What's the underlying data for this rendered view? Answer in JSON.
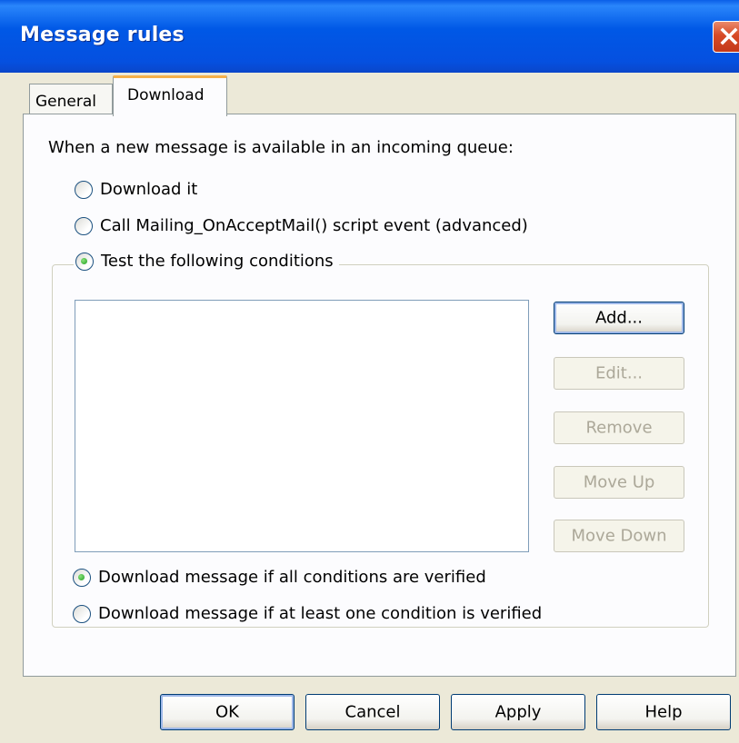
{
  "window": {
    "title": "Message rules",
    "close_icon": "close-icon"
  },
  "tabs": [
    {
      "label": "General",
      "active": false
    },
    {
      "label": "Download",
      "active": true
    }
  ],
  "content": {
    "intro": "When a new message is available in an incoming queue:",
    "options": [
      {
        "label": "Download it",
        "checked": false
      },
      {
        "label": "Call Mailing_OnAcceptMail() script event (advanced)",
        "checked": false
      },
      {
        "label": "Test the following conditions",
        "checked": true
      }
    ],
    "conditions": {
      "items": [],
      "buttons": [
        {
          "label": "Add...",
          "enabled": true
        },
        {
          "label": "Edit...",
          "enabled": false
        },
        {
          "label": "Remove",
          "enabled": false
        },
        {
          "label": "Move Up",
          "enabled": false
        },
        {
          "label": "Move Down",
          "enabled": false
        }
      ],
      "mode_options": [
        {
          "label": "Download message if all conditions are verified",
          "checked": true
        },
        {
          "label": "Download message if at least one condition is verified",
          "checked": false
        }
      ]
    }
  },
  "footer": {
    "ok": "OK",
    "cancel": "Cancel",
    "apply": "Apply",
    "help": "Help"
  },
  "colors": {
    "titlebar": "#0058e6",
    "close": "#d74a26",
    "radio_checked": "#21a121",
    "tab_highlight": "#f5b04a"
  }
}
